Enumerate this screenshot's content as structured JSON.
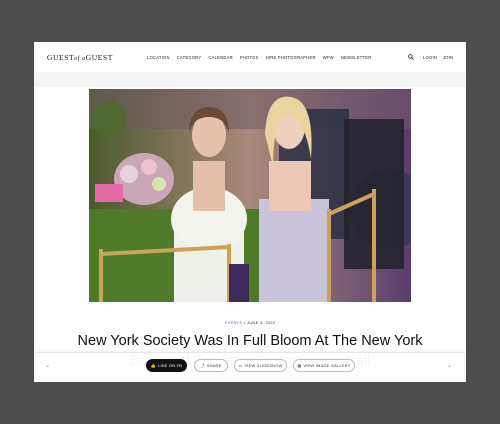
{
  "header": {
    "logo_left": "GUEST",
    "logo_of": "of a",
    "logo_right": "GUEST",
    "nav": [
      "LOCATION",
      "CATEGORY",
      "CALENDAR",
      "PHOTOS",
      "HIRE PHOTOGRAPHER",
      "WFW",
      "NEWSLETTER"
    ],
    "login": "LOGIN",
    "join": "JOIN"
  },
  "article": {
    "category": "EVENTS",
    "separator": "•",
    "date": "JUNE 3, 2022",
    "title": "New York Society Was In Full Bloom At The New York Botanical Garden's Conservatory Ball"
  },
  "actions": {
    "like": "LIKE ON FB",
    "share": "SHARE",
    "slideshow": "VIEW SLIDESHOW",
    "gallery": "VIEW IMAGE GALLERY"
  },
  "icons": [
    "search-icon",
    "thumbs-up-icon",
    "share-icon",
    "slideshow-icon",
    "gallery-icon",
    "chevron-down-icon",
    "chevron-down-icon"
  ],
  "colors": {
    "background": "#4d4d4d",
    "category_link": "#4a6fbf",
    "like_button": "#111111"
  }
}
